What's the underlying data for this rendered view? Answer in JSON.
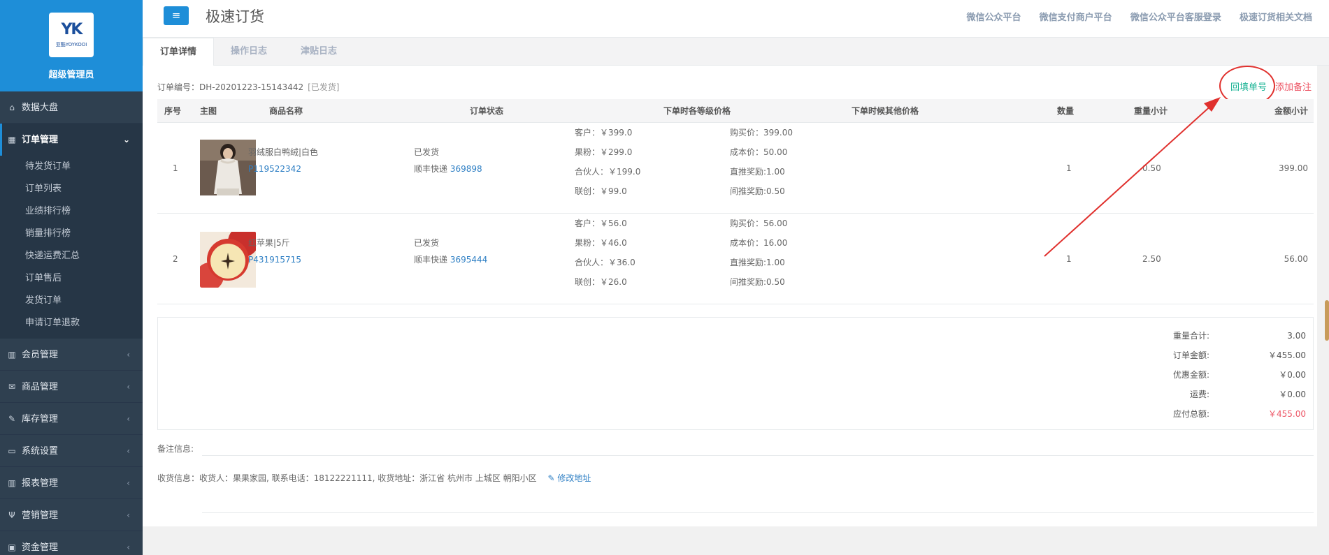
{
  "sidebar": {
    "admin_name": "超级管理员",
    "logo_text": "YK",
    "logo_sub": "亚酷YOYKOOI",
    "items": [
      {
        "label": "数据大盘",
        "icon": "home-icon",
        "glyph": "⌂",
        "has_arrow": false,
        "active": false
      },
      {
        "label": "订单管理",
        "icon": "grid-icon",
        "glyph": "▦",
        "has_arrow": true,
        "active": true,
        "arrow": "⌄",
        "children": [
          "待发货订单",
          "订单列表",
          "业绩排行榜",
          "销量排行榜",
          "快递运费汇总",
          "订单售后",
          "发货订单",
          "申请订单退款"
        ]
      },
      {
        "label": "会员管理",
        "icon": "bar-chart-icon",
        "glyph": "▥",
        "has_arrow": true,
        "arrow": "‹"
      },
      {
        "label": "商品管理",
        "icon": "envelope-icon",
        "glyph": "✉",
        "has_arrow": true,
        "arrow": "‹"
      },
      {
        "label": "库存管理",
        "icon": "edit-icon",
        "glyph": "✎",
        "has_arrow": true,
        "arrow": "‹"
      },
      {
        "label": "系统设置",
        "icon": "desktop-icon",
        "glyph": "▭",
        "has_arrow": true,
        "arrow": "‹"
      },
      {
        "label": "报表管理",
        "icon": "bar-chart-icon",
        "glyph": "▥",
        "has_arrow": true,
        "arrow": "‹"
      },
      {
        "label": "营销管理",
        "icon": "cutlery-icon",
        "glyph": "Ψ",
        "has_arrow": true,
        "arrow": "‹"
      },
      {
        "label": "资金管理",
        "icon": "money-icon",
        "glyph": "▣",
        "has_arrow": true,
        "arrow": "‹"
      }
    ]
  },
  "header": {
    "menu_glyph": "≡",
    "title": "极速订货",
    "links": [
      "微信公众平台",
      "微信支付商户平台",
      "微信公众平台客服登录",
      "极速订货相关文档"
    ]
  },
  "tabs": [
    "订单详情",
    "操作日志",
    "津贴日志"
  ],
  "order": {
    "number_label": "订单编号：",
    "number": "DH-20201223-15143442",
    "status": "[已发货]",
    "fill_tracking": "回填单号",
    "add_remark": "添加备注"
  },
  "table": {
    "headers": [
      "序号",
      "主图",
      "商品名称",
      "订单状态",
      "下单时各等级价格",
      "下单时候其他价格",
      "数量",
      "重量小计",
      "金额小计"
    ],
    "rows": [
      {
        "index": "1",
        "name": "羽绒服白鸭绒|白色",
        "code": "P119522342",
        "status": "已发货",
        "courier": "顺丰快递",
        "tracking": "369898",
        "level_prices": [
          "客户：￥399.0",
          "果粉：￥299.0",
          "合伙人：￥199.0",
          "联创：￥99.0"
        ],
        "other_prices": [
          "购买价：399.00",
          "成本价：50.00",
          "直推奖励:1.00",
          "间推奖励:0.50"
        ],
        "qty": "1",
        "weight": "0.50",
        "amount": "399.00"
      },
      {
        "index": "2",
        "name": "红苹果|5斤",
        "code": "P431915715",
        "status": "已发货",
        "courier": "顺丰快递",
        "tracking": "3695444",
        "level_prices": [
          "客户：￥56.0",
          "果粉：￥46.0",
          "合伙人：￥36.0",
          "联创：￥26.0"
        ],
        "other_prices": [
          "购买价：56.00",
          "成本价：16.00",
          "直推奖励:1.00",
          "间推奖励:0.50"
        ],
        "qty": "1",
        "weight": "2.50",
        "amount": "56.00"
      }
    ]
  },
  "summary": [
    {
      "label": "重量合计:",
      "value": "3.00"
    },
    {
      "label": "订单金额:",
      "value": "￥455.00"
    },
    {
      "label": "优惠金额:",
      "value": "￥0.00"
    },
    {
      "label": "运费:",
      "value": "￥0.00"
    },
    {
      "label": "应付总额:",
      "value": "￥455.00"
    }
  ],
  "remarks_label": "备注信息:",
  "address": {
    "text": "收货信息：收货人：果果家园,   联系电话：18122221111,   收货地址：浙江省 杭州市 上城区 朝阳小区",
    "edit_glyph": "✎",
    "edit_label": "修改地址"
  },
  "colors": {
    "sidebar_bg": "#2f4050",
    "sidebar_head": "#1e8ed8",
    "accent_green": "#1ab394",
    "accent_red": "#ed5565",
    "link_blue": "#2e7fc4",
    "annotation_red": "#e0302d"
  }
}
